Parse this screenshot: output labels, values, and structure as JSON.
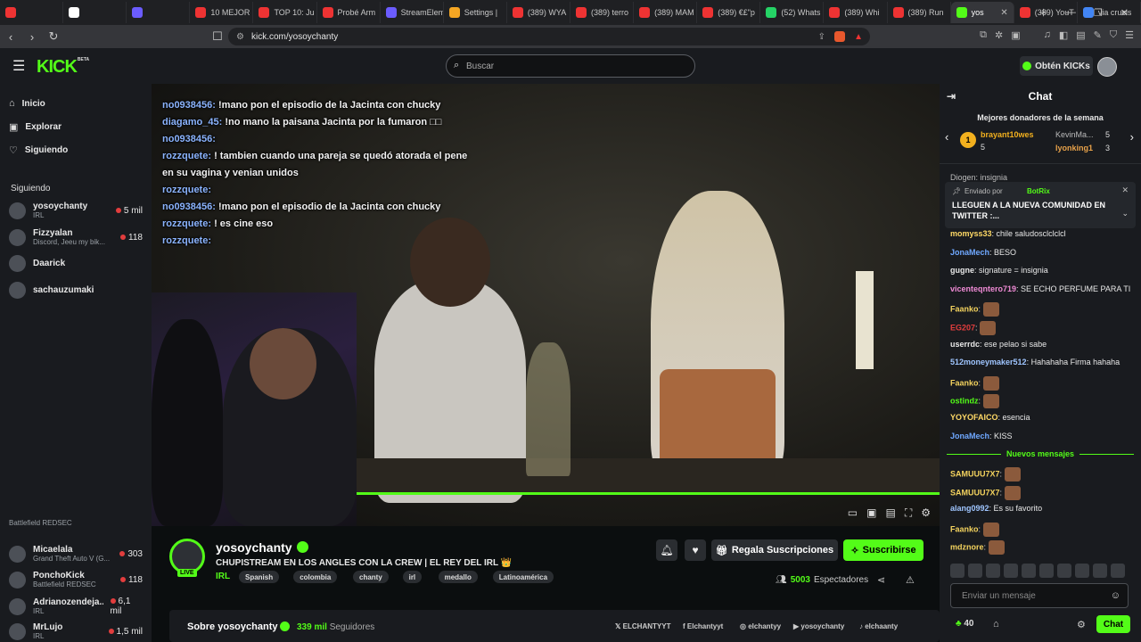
{
  "browser": {
    "tabs": [
      {
        "label": "",
        "color": "#e33"
      },
      {
        "label": "",
        "color": "#fff"
      },
      {
        "label": "",
        "color": "#6b5cff"
      },
      {
        "label": "10 MEJOR",
        "color": "#e33"
      },
      {
        "label": "TOP 10: Ju",
        "color": "#e33"
      },
      {
        "label": "Probé Arm",
        "color": "#e33"
      },
      {
        "label": "StreamElem",
        "color": "#6b5cff"
      },
      {
        "label": "Settings |",
        "color": "#f5a623"
      },
      {
        "label": "(389) WYA",
        "color": "#e33"
      },
      {
        "label": "(389) terro",
        "color": "#e33"
      },
      {
        "label": "(389) MAM",
        "color": "#e33"
      },
      {
        "label": "(389) €£\"p",
        "color": "#e33"
      },
      {
        "label": "(52) Whats",
        "color": "#25d366"
      },
      {
        "label": "(389) Whi",
        "color": "#e33"
      },
      {
        "label": "(389) Run",
        "color": "#e33"
      },
      {
        "label": "yos",
        "color": "#53fc18",
        "active": true
      },
      {
        "label": "(389) YouT",
        "color": "#e33"
      },
      {
        "label": "via crucis",
        "color": "#4285f4"
      }
    ],
    "url": "kick.com/yosoychanty"
  },
  "header": {
    "logo": "KICK",
    "beta": "BETA",
    "search_placeholder": "Buscar",
    "kicks_button": "Obtén KICKs"
  },
  "sidebar": {
    "nav": [
      {
        "label": "Inicio"
      },
      {
        "label": "Explorar"
      },
      {
        "label": "Siguiendo"
      }
    ],
    "section": "Siguiendo",
    "channels_top": [
      {
        "name": "yosoychanty",
        "sub": "IRL",
        "count": "5 mil"
      },
      {
        "name": "Fizzyalan",
        "sub": "Discord, Jeeu my bik...",
        "count": "118"
      },
      {
        "name": "Daarick",
        "sub": "",
        "count": ""
      },
      {
        "name": "sachauzumaki",
        "sub": "",
        "count": ""
      }
    ],
    "channels_bottom": [
      {
        "name": "",
        "sub": "Battlefield REDSEC",
        "count": ""
      },
      {
        "name": "Micaelala",
        "sub": "Grand Theft Auto V (G...",
        "count": "303"
      },
      {
        "name": "PonchoKick",
        "sub": "Battlefield REDSEC",
        "count": "118"
      },
      {
        "name": "Adrianozendeja...",
        "sub": "IRL",
        "count": "6,1 mil"
      },
      {
        "name": "MrLujo",
        "sub": "IRL",
        "count": "1,5 mil"
      }
    ]
  },
  "overlay_chat": [
    {
      "user": "no0938456:",
      "text": "!mano pon el episodio de la Jacinta con chucky"
    },
    {
      "user": "diagamo_45:",
      "text": "!no mano la paisana Jacinta por la fumaron □□"
    },
    {
      "user": "no0938456:",
      "text": ""
    },
    {
      "user": "rozzquete:",
      "text": "! tambien cuando una pareja se quedó atorada el pene"
    },
    {
      "user": "",
      "text": "en su vagina y venian unidos"
    },
    {
      "user": "rozzquete:",
      "text": ""
    },
    {
      "user": "no0938456:",
      "text": "!mano pon el episodio de la Jacinta con chucky"
    },
    {
      "user": "rozzquete:",
      "text": "! es cine eso"
    },
    {
      "user": "rozzquete:",
      "text": ""
    }
  ],
  "stream": {
    "channel": "yosoychanty",
    "live": "LIVE",
    "title": "CHUPISTREAM EN LOS ANGLES CON LA CREW  | EL REY DEL IRL 👑",
    "category": "IRL",
    "tags": [
      "Spanish",
      "colombia",
      "chanty",
      "irl",
      "medallo",
      "Latinoamérica"
    ],
    "gift_button": "Regala Suscripciones",
    "subscribe_button": "Suscribirse",
    "viewers": "5003",
    "viewers_label": "Espectadores",
    "about_title": "Sobre yosoychanty",
    "followers": "339 mil",
    "followers_label": "Seguidores",
    "socials": [
      "ELCHANTYYT",
      "Elchantyyt",
      "elchantyy",
      "yosoychanty",
      "elchaanty"
    ]
  },
  "chat": {
    "title": "Chat",
    "donors_title": "Mejores donadores de la semana",
    "donors": [
      {
        "rank": "1",
        "name": "brayant10wes",
        "amount": "5"
      },
      {
        "name": "KevinMa...",
        "amount": "5"
      },
      {
        "name": "lyonking1",
        "amount": "3"
      }
    ],
    "peek": "Diogen: insignia",
    "pinned_by": "Enviado por",
    "pinned_user": "BotRix",
    "pinned_text": "LLEGUEN A LA NUEVA COMUNIDAD EN TWITTER",
    "pinned_more": ":...",
    "messages": [
      {
        "user": "momyss33",
        "color": "#ffd966",
        "text": "chile saludosclclclcl"
      },
      {
        "user": "JonaMech",
        "color": "#6fa8ff",
        "text": "BESO"
      },
      {
        "user": "gugne",
        "color": "#e8e8e8",
        "text": "signature = insignia"
      },
      {
        "user": "vicenteqntero719",
        "color": "#f08bd6",
        "text": "SE ECHO PERFUME PARA TI"
      },
      {
        "user": "Faanko",
        "color": "#f4d35e",
        "text": "",
        "emote": true
      },
      {
        "user": "EG207",
        "color": "#e23d3d",
        "text": "",
        "emote": true
      },
      {
        "user": "userrdc",
        "color": "#e8e8e8",
        "text": "ese pelao si sabe"
      },
      {
        "user": "512moneymaker512",
        "color": "#9fc5ff",
        "text": "Hahahaha Firma hahaha"
      },
      {
        "user": "Faanko",
        "color": "#f4d35e",
        "text": "",
        "emote": true
      },
      {
        "user": "ostindz",
        "color": "#53fc18",
        "text": "",
        "emote": true
      },
      {
        "user": "YOYOFAICO",
        "color": "#ffd966",
        "text": "esencia"
      },
      {
        "user": "JonaMech",
        "color": "#6fa8ff",
        "text": "KISS"
      }
    ],
    "new_messages": "Nuevos mensajes",
    "messages_new": [
      {
        "user": "SAMUUU7X7",
        "color": "#f4d35e",
        "text": "",
        "emote": true
      },
      {
        "user": "SAMUUU7X7",
        "color": "#f4d35e",
        "text": "",
        "emote": true
      },
      {
        "user": "alang0992",
        "color": "#9fc5ff",
        "text": "Es su favorito"
      },
      {
        "user": "Faanko",
        "color": "#f4d35e",
        "text": "",
        "emote": true
      },
      {
        "user": "mdznore",
        "color": "#f4d35e",
        "text": "",
        "emote": true
      }
    ],
    "input_placeholder": "Enviar un mensaje",
    "points": "40",
    "send_button": "Chat"
  }
}
